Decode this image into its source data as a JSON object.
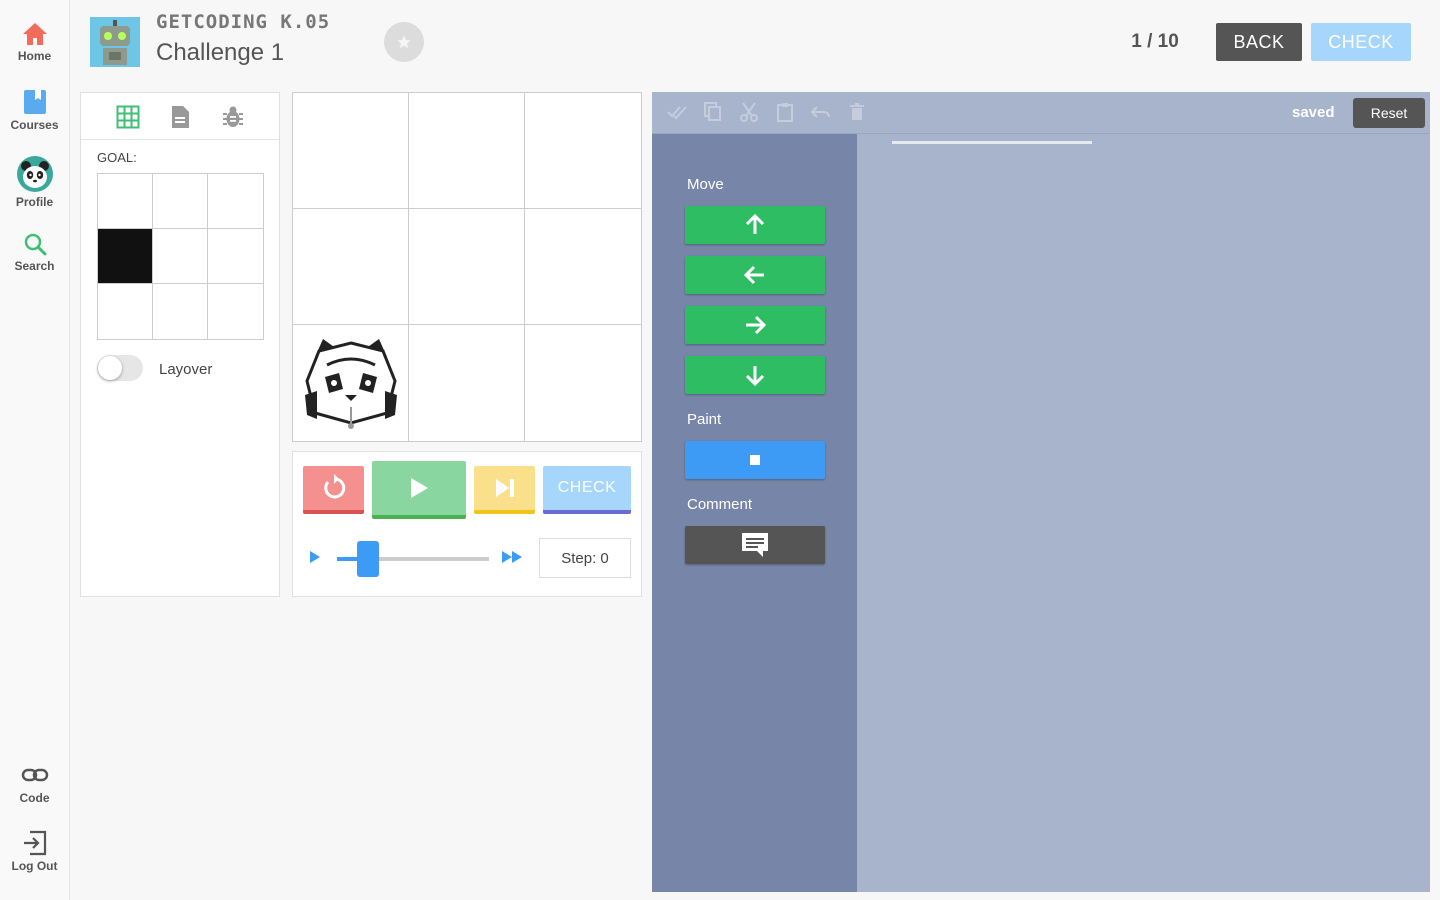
{
  "sidebar": {
    "items": [
      {
        "label": "Home",
        "icon": "home-icon"
      },
      {
        "label": "Courses",
        "icon": "book-icon"
      },
      {
        "label": "Profile",
        "icon": "panda-avatar"
      },
      {
        "label": "Search",
        "icon": "search-icon"
      },
      {
        "label": "Code",
        "icon": "link-icon"
      },
      {
        "label": "Log Out",
        "icon": "logout-icon"
      }
    ]
  },
  "header": {
    "course_name": "GETCODING K.05",
    "challenge_name": "Challenge 1",
    "progress": "1 / 10",
    "back_label": "BACK",
    "check_label": "CHECK"
  },
  "goal": {
    "label": "GOAL:",
    "tabs": [
      "grid-icon",
      "document-icon",
      "bug-icon"
    ],
    "grid": [
      [
        0,
        0,
        0
      ],
      [
        1,
        0,
        0
      ],
      [
        0,
        0,
        0
      ]
    ],
    "layover_label": "Layover",
    "layover_on": false
  },
  "stage": {
    "rows": 3,
    "cols": 3,
    "panda_cell": [
      2,
      0
    ]
  },
  "controls": {
    "check_label": "CHECK",
    "step_text": "Step: 0",
    "speed_level": 0.15
  },
  "editor": {
    "saved_text": "saved",
    "reset_label": "Reset",
    "toolbar_icons": [
      "check-all-icon",
      "copy-icon",
      "cut-icon",
      "paste-icon",
      "undo-icon",
      "delete-icon"
    ],
    "categories": {
      "move": "Move",
      "paint": "Paint",
      "comment": "Comment"
    },
    "blocks": {
      "move": [
        "arrow-up-icon",
        "arrow-left-icon",
        "arrow-right-icon",
        "arrow-down-icon"
      ],
      "paint": "square-icon",
      "comment": "comment-icon"
    }
  },
  "colors": {
    "accent_green": "#2ebd63",
    "accent_blue": "#3d9af5",
    "palette_bg": "#7786a8",
    "workspace_bg": "#a8b4cc",
    "home_icon": "#f26b5b"
  }
}
